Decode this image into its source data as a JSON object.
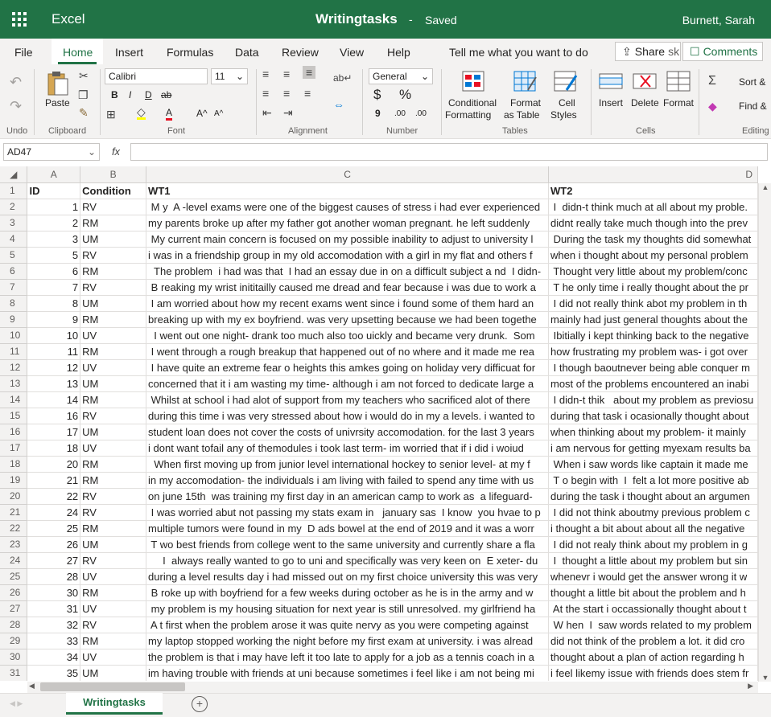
{
  "app": {
    "name": "Excel",
    "doc_title": "Writingtasks",
    "separator": "-",
    "status": "Saved",
    "user": "Burnett, Sarah"
  },
  "tabs": [
    "File",
    "Home",
    "Insert",
    "Formulas",
    "Data",
    "Review",
    "View",
    "Help"
  ],
  "tell_me": "Tell me what you want to do",
  "share_label": "Share",
  "share_tail": "sk",
  "comments_label": "Comments",
  "ribbon": {
    "undo_group": "Undo",
    "clipboard_group": "Clipboard",
    "font_group": "Font",
    "alignment_group": "Alignment",
    "number_group": "Number",
    "tables_group": "Tables",
    "cells_group": "Cells",
    "editing_group": "Editing",
    "paste": "Paste",
    "font_name": "Calibri",
    "font_size": "11",
    "bold": "B",
    "italic": "I",
    "underline": "D",
    "strike": "ab",
    "number_format": "General",
    "currency": "$",
    "percent": "%",
    "cond_format_1": "Conditional",
    "cond_format_2": "Formatting",
    "format_table_1": "Format",
    "format_table_2": "as Table",
    "cell_styles_1": "Cell",
    "cell_styles_2": "Styles",
    "insert": "Insert",
    "delete": "Delete",
    "format": "Format",
    "sort": "Sort &",
    "find": "Find &",
    "dec_inc": ".00",
    "dec_dec": ".00",
    "comma": "9",
    "font_grow": "A^",
    "font_shrink": "A^",
    "font_color": "A"
  },
  "namebox": "AD47",
  "fx": "fx",
  "columns": [
    "A",
    "B",
    "C",
    "D"
  ],
  "header_row": {
    "id": "ID",
    "condition": "Condition",
    "wt1": "WT1",
    "wt2": "WT2"
  },
  "rows": [
    {
      "r": "2",
      "id": "1",
      "c": "RV",
      "wt1": " M y  A -level exams were one of the biggest causes of stress i had ever experienced",
      "wt2": " I  didn-t think much at all about my proble."
    },
    {
      "r": "3",
      "id": "2",
      "c": "RM",
      "wt1": "my parents broke up after my father got another woman pregnant. he left suddenly",
      "wt2": "didnt really take much though into the prev"
    },
    {
      "r": "4",
      "id": "3",
      "c": "UM",
      "wt1": " My current main concern is focused on my possible inability to adjust to university l",
      "wt2": " During the task my thoughts did somewhat"
    },
    {
      "r": "5",
      "id": "5",
      "c": "RV",
      "wt1": "i was in a friendship group in my old accomodation with a girl in my flat and others f",
      "wt2": "when i thought about my personal problem"
    },
    {
      "r": "6",
      "id": "6",
      "c": "RM",
      "wt1": "  The problem  i had was that  I had an essay due in on a difficult subject a nd  I didn-",
      "wt2": " Thought very little about my problem/conc"
    },
    {
      "r": "7",
      "id": "7",
      "c": "RV",
      "wt1": " B reaking my wrist inititailly caused me dread and fear because i was due to work a",
      "wt2": " T he only time i really thought about the pr"
    },
    {
      "r": "8",
      "id": "8",
      "c": "UM",
      "wt1": " I am worried about how my recent exams went since i found some of them hard an",
      "wt2": " I did not really think abot my problem in th"
    },
    {
      "r": "9",
      "id": "9",
      "c": "RM",
      "wt1": "breaking up with my ex boyfriend. was very upsetting because we had been togethe",
      "wt2": "mainly had just general thoughts about the"
    },
    {
      "r": "10",
      "id": "10",
      "c": "UV",
      "wt1": "  I went out one night- drank too much also too uickly and became very drunk.  Som",
      "wt2": " Ibitially i kept thinking back to the negative"
    },
    {
      "r": "11",
      "id": "11",
      "c": "RM",
      "wt1": " I went through a rough breakup that happened out of no where and it made me rea",
      "wt2": "how frustrating my problem was- i got over"
    },
    {
      "r": "12",
      "id": "12",
      "c": "UV",
      "wt1": " I have quite an extreme fear o heights this amkes going on holiday very difficuat for",
      "wt2": " I though baoutnever being able conquer m"
    },
    {
      "r": "13",
      "id": "13",
      "c": "UM",
      "wt1": "concerned that it i am wasting my time- although i am not forced to dedicate large a",
      "wt2": "most of the problems encountered an inabi"
    },
    {
      "r": "14",
      "id": "14",
      "c": "RM",
      "wt1": " Whilst at school i had alot of support from my teachers who sacrificed alot of there",
      "wt2": " I didn-t thik   about my problem as previosu"
    },
    {
      "r": "15",
      "id": "16",
      "c": "RV",
      "wt1": "during this time i was very stressed about how i would do in my a levels. i wanted to",
      "wt2": "during that task i ocasionally thought about"
    },
    {
      "r": "16",
      "id": "17",
      "c": "UM",
      "wt1": "student loan does not cover the costs of univrsity accomodation. for the last 3 years",
      "wt2": "when thinking about my problem- it mainly"
    },
    {
      "r": "17",
      "id": "18",
      "c": "UV",
      "wt1": "i dont want tofail any of themodules i took last term- im worried that if i did i woiud",
      "wt2": "i am nervous for getting myexam results ba"
    },
    {
      "r": "18",
      "id": "20",
      "c": "RM",
      "wt1": "  When first moving up from junior level international hockey to senior level- at my f",
      "wt2": " When i saw words like captain it made me"
    },
    {
      "r": "19",
      "id": "21",
      "c": "RM",
      "wt1": "in my accomodation- the individuals i am living with failed to spend any time with us",
      "wt2": " T o begin with  I  felt a lot more positive ab"
    },
    {
      "r": "20",
      "id": "22",
      "c": "RV",
      "wt1": "on june 15th  was training my first day in an american camp to work as  a lifeguard-",
      "wt2": "during the task i thought about an argumen"
    },
    {
      "r": "21",
      "id": "24",
      "c": "RV",
      "wt1": " I was worried abut not passing my stats exam in   january sas  I know  you hvae to p",
      "wt2": " I did not think aboutmy previous problem c"
    },
    {
      "r": "22",
      "id": "25",
      "c": "RM",
      "wt1": "multiple tumors were found in my  D ads bowel at the end of 2019 and it was a worr",
      "wt2": "i thought a bit about about all the negative"
    },
    {
      "r": "23",
      "id": "26",
      "c": "UM",
      "wt1": " T wo best friends from college went to the same university and currently share a fla",
      "wt2": " I did not realy think about my problem in g"
    },
    {
      "r": "24",
      "id": "27",
      "c": "RV",
      "wt1": "     I  always really wanted to go to uni and specifically was very keen on  E xeter- du",
      "wt2": " I  thought a little about my problem but sin"
    },
    {
      "r": "25",
      "id": "28",
      "c": "UV",
      "wt1": "during a level results day i had missed out on my first choice university this was very",
      "wt2": "whenevr i would get the answer wrong it w"
    },
    {
      "r": "26",
      "id": "30",
      "c": "RM",
      "wt1": " B roke up with boyfriend for a few weeks during october as he is in the army and w",
      "wt2": "thought a little bit about the problem and h"
    },
    {
      "r": "27",
      "id": "31",
      "c": "UV",
      "wt1": " my problem is my housing situation for next year is still unresolved. my girlfriend ha",
      "wt2": " At the start i occassionally thought about t"
    },
    {
      "r": "28",
      "id": "32",
      "c": "RV",
      "wt1": " A t first when the problem arose it was quite nervy as you were competing against",
      "wt2": " W hen  I  saw words related to my problem"
    },
    {
      "r": "29",
      "id": "33",
      "c": "RM",
      "wt1": "my laptop stopped working the night before my first exam at university. i was alread",
      "wt2": "did not think of the problem a lot. it did cro"
    },
    {
      "r": "30",
      "id": "34",
      "c": "UV",
      "wt1": "the problem is that i may have left it too late to apply for a job as a tennis coach in a",
      "wt2": "thought about a plan of action regarding h"
    },
    {
      "r": "31",
      "id": "35",
      "c": "UM",
      "wt1": "im having trouble with friends at uni because sometimes i feel like i am not being mi",
      "wt2": "i feel likemy issue with friends does stem fr"
    }
  ],
  "sheet_tab": "Writingtasks",
  "add_sheet": "+",
  "colors": {
    "brand": "#217346",
    "ribbon_bg": "#f3f2f1"
  }
}
